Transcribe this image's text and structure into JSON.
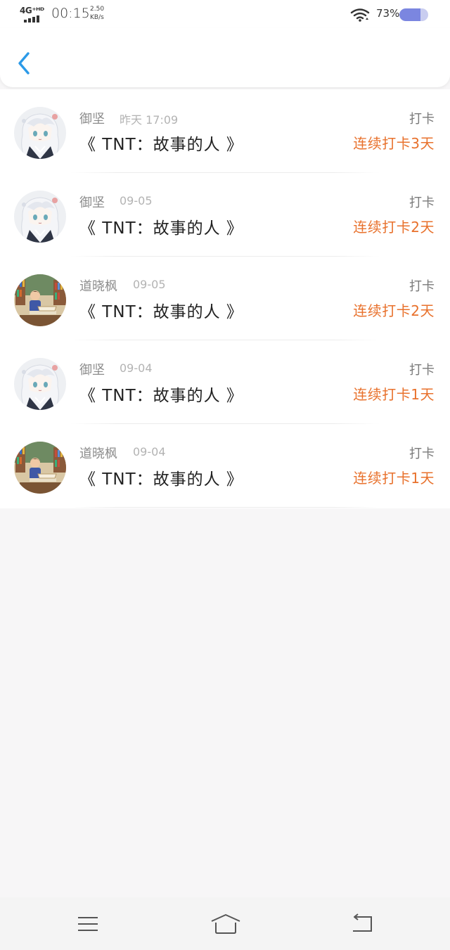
{
  "status_bar": {
    "network": "4G⁺ᴴᴰ",
    "time": "00:15",
    "speed_value": "2.50",
    "speed_unit": "KB/s",
    "battery": "73%",
    "battery_level": 0.73
  },
  "header": {
    "back_icon": "chevron-left-icon"
  },
  "checkins": [
    {
      "name": "御坚",
      "date": "昨天 17:09",
      "title": "《 TNT：故事的人 》",
      "tag": "打卡",
      "streak": "连续打卡3天",
      "avatar": "anime-girl"
    },
    {
      "name": "御坚",
      "date": "09-05",
      "title": "《 TNT：故事的人 》",
      "tag": "打卡",
      "streak": "连续打卡2天",
      "avatar": "anime-girl"
    },
    {
      "name": "道晓枫",
      "date": "09-05",
      "title": "《 TNT：故事的人 》",
      "tag": "打卡",
      "streak": "连续打卡2天",
      "avatar": "reading-boy"
    },
    {
      "name": "御坚",
      "date": "09-04",
      "title": "《 TNT：故事的人 》",
      "tag": "打卡",
      "streak": "连续打卡1天",
      "avatar": "anime-girl"
    },
    {
      "name": "道晓枫",
      "date": "09-04",
      "title": "《 TNT：故事的人 》",
      "tag": "打卡",
      "streak": "连续打卡1天",
      "avatar": "reading-boy"
    }
  ],
  "nav": {
    "menu_icon": "menu-icon",
    "home_icon": "home-icon",
    "back_icon": "back-icon"
  },
  "colors": {
    "accent": "#2b9ae8",
    "streak": "#e8712c",
    "background": "#f7f6f7"
  }
}
